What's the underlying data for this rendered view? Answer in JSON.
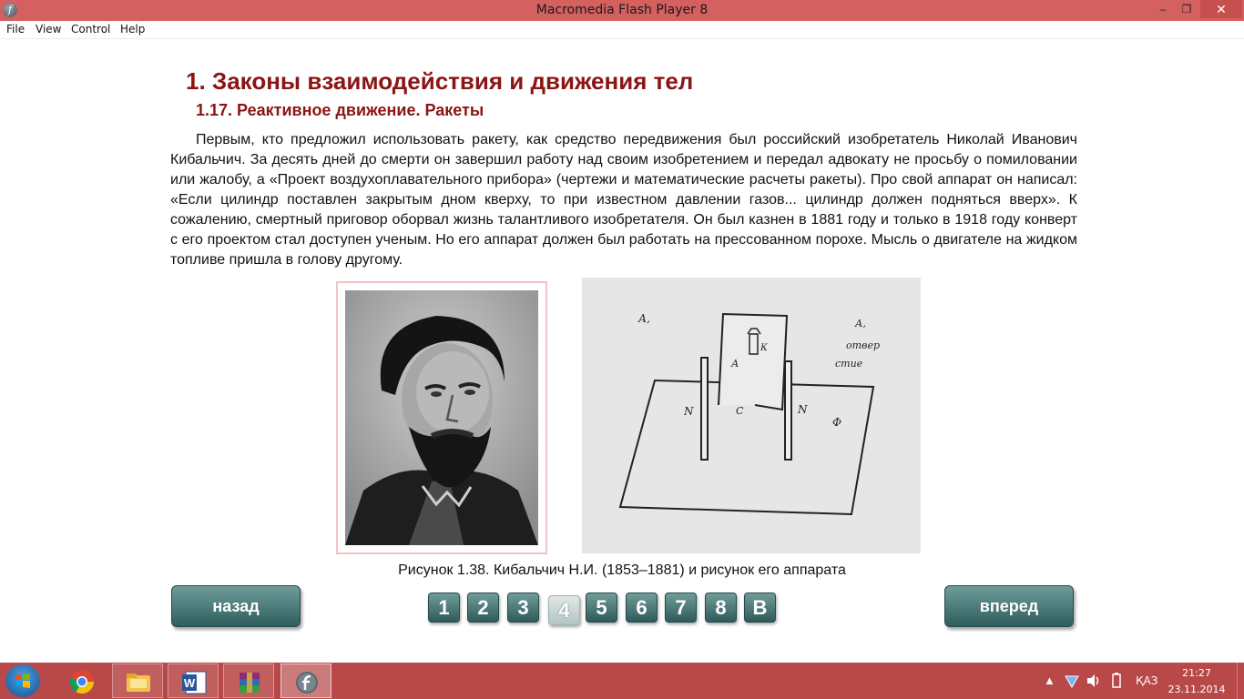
{
  "window": {
    "title": "Macromedia Flash Player 8",
    "minimize": "–",
    "maximize": "❐",
    "close": "✕"
  },
  "menu": [
    "File",
    "View",
    "Control",
    "Help"
  ],
  "content": {
    "heading": "1. Законы взаимодействия и движения тел",
    "subheading": "1.17. Реактивное движение. Ракеты",
    "paragraph": "Первым, кто предложил использовать ракету, как средство передвижения был российский изобретатель Николай Иванович Кибальчич. За десять дней до смерти он завершил работу над своим изобретением и передал адвокату не просьбу о помиловании или жалобу, а «Проект воздухоплавательного прибора» (чертежи и математические расчеты ракеты). Про свой аппарат он написал: «Если цилиндр поставлен закрытым дном кверху, то при известном давлении газов... цилиндр должен подняться вверх». К сожалению, смертный приговор оборвал жизнь талантливого изобретателя. Он был казнен в 1881 году и только в 1918 году конверт с его проектом стал доступен ученым. Но его аппарат должен был работать на прессованном порохе. Мысль о двигателе на жидком топливе пришла в голову другому.",
    "caption": "Рисунок 1.38. Кибальчич Н.И. (1853–1881) и рисунок его аппарата",
    "drawing_labels": {
      "top_left": "А,",
      "top_right_1": "А,",
      "top_right_2": "отвер",
      "top_right_3": "стие",
      "k": "К",
      "a": "А",
      "n_left": "N",
      "c": "С",
      "n_right": "N",
      "f": "Ф"
    }
  },
  "nav": {
    "back_label": "назад",
    "forward_label": "вперед",
    "pages": [
      "1",
      "2",
      "3",
      "4",
      "5",
      "6",
      "7",
      "8",
      "В"
    ],
    "active_page": "4"
  },
  "taskbar": {
    "apps": [
      "chrome-icon",
      "file-explorer-icon",
      "word-icon",
      "winrar-icon",
      "flash-player-icon"
    ],
    "language": "ҚАЗ",
    "time": "21:27",
    "date": "23.11.2014"
  },
  "colors": {
    "titlebar": "#d4605f",
    "taskbar": "#b94848",
    "heading": "#8b1414",
    "button_dark": "#2f5e5c",
    "button_light": "#6e9c9a"
  }
}
